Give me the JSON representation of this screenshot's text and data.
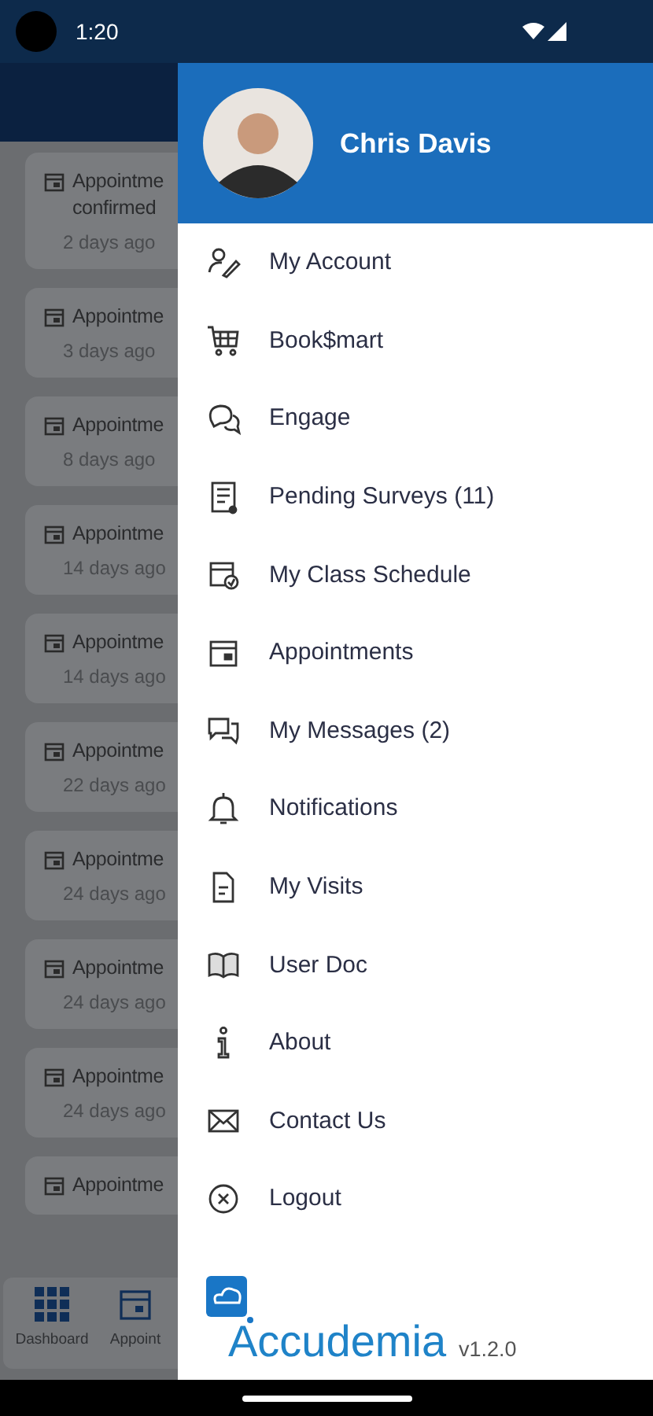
{
  "status_bar": {
    "time": "1:20"
  },
  "background_list": [
    {
      "title": "Appointme",
      "subtitle": "confirmed",
      "time": "2 days ago"
    },
    {
      "title": "Appointme",
      "time": "3 days ago"
    },
    {
      "title": "Appointme",
      "time": "8 days ago"
    },
    {
      "title": "Appointme",
      "time": "14 days ago"
    },
    {
      "title": "Appointme",
      "time": "14 days ago"
    },
    {
      "title": "Appointme",
      "time": "22 days ago"
    },
    {
      "title": "Appointme",
      "time": "24 days ago"
    },
    {
      "title": "Appointme",
      "time": "24 days ago"
    },
    {
      "title": "Appointme",
      "time": "24 days ago"
    },
    {
      "title": "Appointme"
    }
  ],
  "bottom_nav": [
    {
      "label": "Dashboard"
    },
    {
      "label": "Appoint"
    }
  ],
  "drawer": {
    "user_name": "Chris Davis",
    "items": [
      {
        "label": "My Account"
      },
      {
        "label": "Book$mart"
      },
      {
        "label": "Engage"
      },
      {
        "label": "Pending Surveys (11)"
      },
      {
        "label": "My Class Schedule"
      },
      {
        "label": "Appointments"
      },
      {
        "label": "My Messages (2)"
      },
      {
        "label": "Notifications"
      },
      {
        "label": "My Visits"
      },
      {
        "label": "User Doc"
      },
      {
        "label": "About"
      },
      {
        "label": "Contact Us"
      },
      {
        "label": "Logout"
      }
    ],
    "logo": "Accudemia",
    "version": "v1.2.0"
  }
}
